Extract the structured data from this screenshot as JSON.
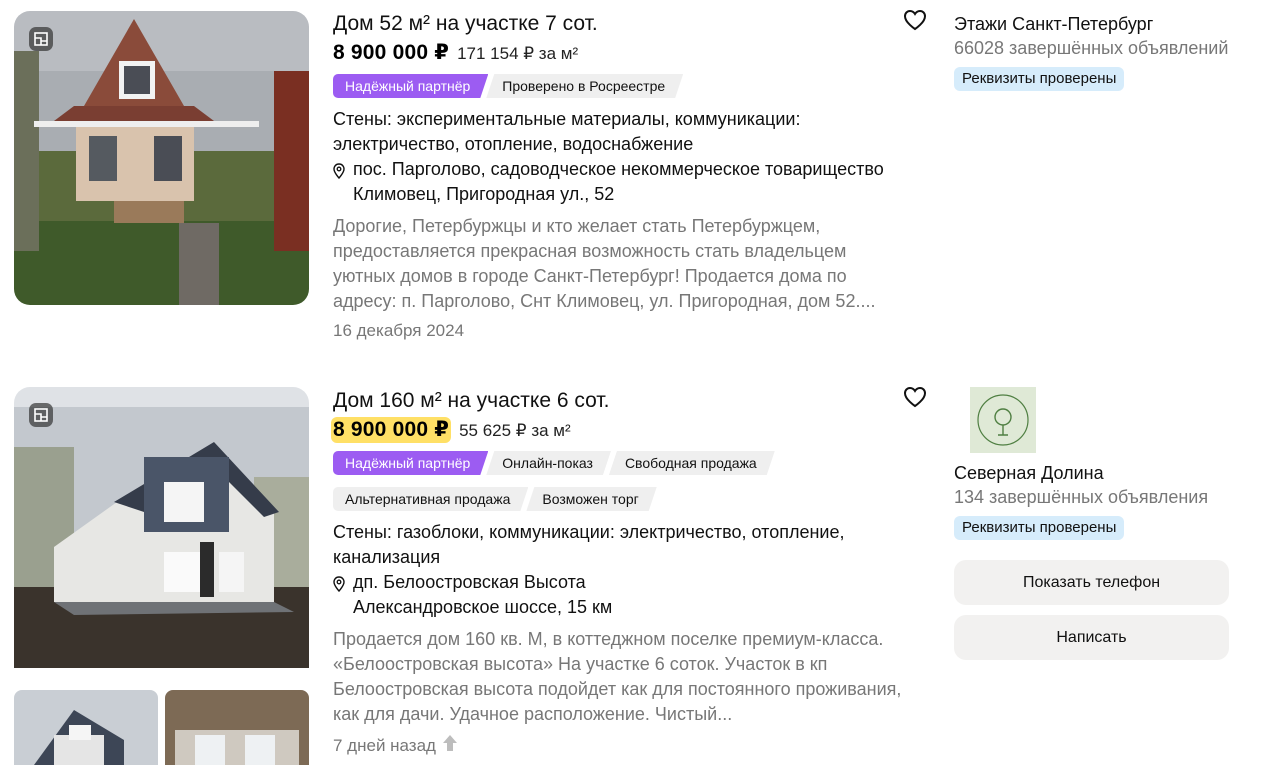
{
  "listings": [
    {
      "title": "Дом 52 м² на участке 7 сот.",
      "price": "8 900 000 ₽",
      "price_per_sqm": "171 154 ₽ за м²",
      "badges": [
        "Надёжный партнёр",
        "Проверено в Росреестре"
      ],
      "params": "Стены: экспериментальные материалы, коммуникации: электричество, отопление, водоснабжение",
      "address": "пос. Парголово, садоводческое некоммерческое товарищество Климовец, Пригородная ул., 52",
      "description": "Дорогие, Петербуржцы и кто желает стать Петербуржцем, предоставляется прекрасная возможность стать владельцем уютных домов в городе Санкт-Петербург! Продается дома по адресу: п. Парголово, Снт Климовец, ул. Пригородная, дом 52....",
      "date": "16 декабря 2024",
      "seller": {
        "name": "Этажи Санкт-Петербург",
        "completed": "66028 завершённых объявлений",
        "verified": "Реквизиты проверены"
      }
    },
    {
      "title": "Дом 160 м² на участке 6 сот.",
      "price": "8 900 000 ₽",
      "price_per_sqm": "55 625 ₽ за м²",
      "badges": [
        "Надёжный партнёр",
        "Онлайн-показ",
        "Свободная продажа",
        "Альтернативная продажа",
        "Возможен торг"
      ],
      "params": "Стены: газоблоки, коммуникации: электричество, отопление, канализация",
      "address": "дп. Белоостровская Высота\nАлександровское шоссе, 15 км",
      "description": "Продается дом 160 кв. М, в коттеджном поселке премиум-класса. «Белоостровская высота» На участке 6 соток. Участок в кп Белоостровская высота подойдет как для постоянного проживания, как для дачи. Удачное расположение. Чистый...",
      "date": "7 дней назад",
      "seller": {
        "name": "Северная Долина",
        "completed": "134 завершённых объявления",
        "verified": "Реквизиты проверены",
        "logo_text": "СЕВЕРНАЯ ДОЛИНА"
      },
      "buttons": {
        "phone": "Показать телефон",
        "write": "Написать"
      }
    }
  ],
  "colors": {
    "partner_badge": "#9c5cf2",
    "price_highlight": "#ffe066",
    "verified_badge": "#d6ecfb",
    "button_bg": "#f2f1f0",
    "muted_text": "#777777"
  },
  "icons": [
    "plan-icon",
    "heart-icon",
    "location-pin-icon",
    "boost-arrow-icon"
  ]
}
